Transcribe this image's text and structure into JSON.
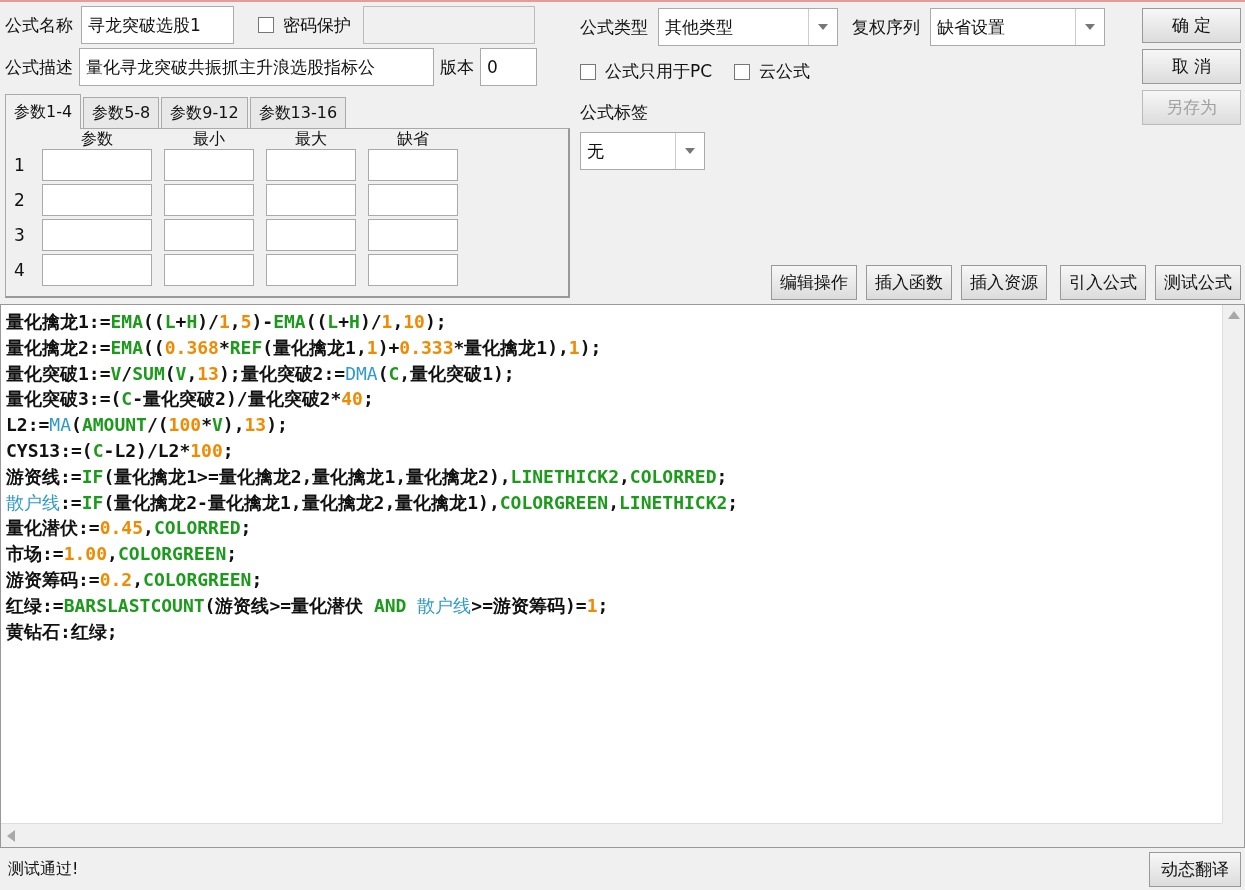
{
  "formula_name": {
    "label": "公式名称",
    "value": "寻龙突破选股1"
  },
  "password": {
    "label": "密码保护",
    "checked": false
  },
  "formula_type": {
    "label": "公式类型",
    "value": "其他类型"
  },
  "adjust_series": {
    "label": "复权序列",
    "value": "缺省设置"
  },
  "description": {
    "label": "公式描述",
    "value": "量化寻龙突破共振抓主升浪选股指标公"
  },
  "version": {
    "label": "版本",
    "value": "0"
  },
  "options": [
    {
      "label": "公式只用于PC",
      "checked": false
    },
    {
      "label": "云公式",
      "checked": false
    }
  ],
  "dialog_buttons": [
    {
      "label": "确 定",
      "disabled": false
    },
    {
      "label": "取 消",
      "disabled": false
    },
    {
      "label": "另存为",
      "disabled": true
    }
  ],
  "tabs": [
    {
      "label": "参数1-4",
      "selected": true
    },
    {
      "label": "参数5-8",
      "selected": false
    },
    {
      "label": "参数9-12",
      "selected": false
    },
    {
      "label": "参数13-16",
      "selected": false
    }
  ],
  "params": {
    "columns": [
      "参数",
      "最小",
      "最大",
      "缺省"
    ],
    "rows": [
      "1",
      "2",
      "3",
      "4"
    ]
  },
  "formula_tag": {
    "label": "公式标签",
    "value": "无"
  },
  "tool_buttons": [
    "编辑操作",
    "插入函数",
    "插入资源",
    "引入公式",
    "测试公式"
  ],
  "code_lines": [
    [
      {
        "text": "量化擒龙1:=",
        "kind": "text"
      },
      {
        "text": "EMA",
        "kind": "func"
      },
      {
        "text": "((",
        "kind": "text"
      },
      {
        "text": "L",
        "kind": "func"
      },
      {
        "text": "+",
        "kind": "text"
      },
      {
        "text": "H",
        "kind": "func"
      },
      {
        "text": ")/",
        "kind": "text"
      },
      {
        "text": "1",
        "kind": "num"
      },
      {
        "text": ",",
        "kind": "text"
      },
      {
        "text": "5",
        "kind": "num"
      },
      {
        "text": ")-",
        "kind": "text"
      },
      {
        "text": "EMA",
        "kind": "func"
      },
      {
        "text": "((",
        "kind": "text"
      },
      {
        "text": "L",
        "kind": "func"
      },
      {
        "text": "+",
        "kind": "text"
      },
      {
        "text": "H",
        "kind": "func"
      },
      {
        "text": ")/",
        "kind": "text"
      },
      {
        "text": "1",
        "kind": "num"
      },
      {
        "text": ",",
        "kind": "text"
      },
      {
        "text": "10",
        "kind": "num"
      },
      {
        "text": ");",
        "kind": "text"
      }
    ],
    [
      {
        "text": "量化擒龙2:=",
        "kind": "text"
      },
      {
        "text": "EMA",
        "kind": "func"
      },
      {
        "text": "((",
        "kind": "text"
      },
      {
        "text": "0.368",
        "kind": "num"
      },
      {
        "text": "*",
        "kind": "text"
      },
      {
        "text": "REF",
        "kind": "func"
      },
      {
        "text": "(量化擒龙1,",
        "kind": "text"
      },
      {
        "text": "1",
        "kind": "num"
      },
      {
        "text": ")+",
        "kind": "text"
      },
      {
        "text": "0.333",
        "kind": "num"
      },
      {
        "text": "*量化擒龙1),",
        "kind": "text"
      },
      {
        "text": "1",
        "kind": "num"
      },
      {
        "text": ");",
        "kind": "text"
      }
    ],
    [
      {
        "text": "量化突破1:=",
        "kind": "text"
      },
      {
        "text": "V",
        "kind": "func"
      },
      {
        "text": "/",
        "kind": "text"
      },
      {
        "text": "SUM",
        "kind": "func"
      },
      {
        "text": "(",
        "kind": "text"
      },
      {
        "text": "V",
        "kind": "func"
      },
      {
        "text": ",",
        "kind": "text"
      },
      {
        "text": "13",
        "kind": "num"
      },
      {
        "text": ");量化突破2:=",
        "kind": "text"
      },
      {
        "text": "DMA",
        "kind": "ident"
      },
      {
        "text": "(",
        "kind": "text"
      },
      {
        "text": "C",
        "kind": "func"
      },
      {
        "text": ",量化突破1);",
        "kind": "text"
      }
    ],
    [
      {
        "text": "量化突破3:=(",
        "kind": "text"
      },
      {
        "text": "C",
        "kind": "func"
      },
      {
        "text": "-量化突破2)/量化突破2*",
        "kind": "text"
      },
      {
        "text": "40",
        "kind": "num"
      },
      {
        "text": ";",
        "kind": "text"
      }
    ],
    [
      {
        "text": "L2:=",
        "kind": "text"
      },
      {
        "text": "MA",
        "kind": "ident"
      },
      {
        "text": "(",
        "kind": "text"
      },
      {
        "text": "AMOUNT",
        "kind": "func"
      },
      {
        "text": "/(",
        "kind": "text"
      },
      {
        "text": "100",
        "kind": "num"
      },
      {
        "text": "*",
        "kind": "text"
      },
      {
        "text": "V",
        "kind": "func"
      },
      {
        "text": "),",
        "kind": "text"
      },
      {
        "text": "13",
        "kind": "num"
      },
      {
        "text": ");",
        "kind": "text"
      }
    ],
    [
      {
        "text": "CYS13:=(",
        "kind": "text"
      },
      {
        "text": "C",
        "kind": "func"
      },
      {
        "text": "-L2)/L2*",
        "kind": "text"
      },
      {
        "text": "100",
        "kind": "num"
      },
      {
        "text": ";",
        "kind": "text"
      }
    ],
    [
      {
        "text": "游资线:=",
        "kind": "text"
      },
      {
        "text": "IF",
        "kind": "func"
      },
      {
        "text": "(量化擒龙1>=量化擒龙2,量化擒龙1,量化擒龙2),",
        "kind": "text"
      },
      {
        "text": "LINETHICK2",
        "kind": "func"
      },
      {
        "text": ",",
        "kind": "text"
      },
      {
        "text": "COLORRED",
        "kind": "func"
      },
      {
        "text": ";",
        "kind": "text"
      }
    ],
    [
      {
        "text": "散户线",
        "kind": "ident"
      },
      {
        "text": ":=",
        "kind": "text"
      },
      {
        "text": "IF",
        "kind": "func"
      },
      {
        "text": "(量化擒龙2-量化擒龙1,量化擒龙2,量化擒龙1),",
        "kind": "text"
      },
      {
        "text": "COLORGREEN",
        "kind": "func"
      },
      {
        "text": ",",
        "kind": "text"
      },
      {
        "text": "LINETHICK2",
        "kind": "func"
      },
      {
        "text": ";",
        "kind": "text"
      }
    ],
    [
      {
        "text": "量化潜伏:=",
        "kind": "text"
      },
      {
        "text": "0.45",
        "kind": "num"
      },
      {
        "text": ",",
        "kind": "text"
      },
      {
        "text": "COLORRED",
        "kind": "func"
      },
      {
        "text": ";",
        "kind": "text"
      }
    ],
    [
      {
        "text": "市场:=",
        "kind": "text"
      },
      {
        "text": "1.00",
        "kind": "num"
      },
      {
        "text": ",",
        "kind": "text"
      },
      {
        "text": "COLORGREEN",
        "kind": "func"
      },
      {
        "text": ";",
        "kind": "text"
      }
    ],
    [
      {
        "text": "游资筹码:=",
        "kind": "text"
      },
      {
        "text": "0.2",
        "kind": "num"
      },
      {
        "text": ",",
        "kind": "text"
      },
      {
        "text": "COLORGREEN",
        "kind": "func"
      },
      {
        "text": ";",
        "kind": "text"
      }
    ],
    [
      {
        "text": "红绿:=",
        "kind": "text"
      },
      {
        "text": "BARSLASTCOUNT",
        "kind": "func"
      },
      {
        "text": "(游资线>=量化潜伏 ",
        "kind": "text"
      },
      {
        "text": "AND ",
        "kind": "func"
      },
      {
        "text": "散户线",
        "kind": "ident"
      },
      {
        "text": ">=游资筹码)=",
        "kind": "text"
      },
      {
        "text": "1",
        "kind": "num"
      },
      {
        "text": ";",
        "kind": "text"
      }
    ],
    [
      {
        "text": "黄钻石:红绿;",
        "kind": "text"
      }
    ]
  ],
  "status_bar": {
    "message": "测试通过!",
    "button": "动态翻译"
  }
}
